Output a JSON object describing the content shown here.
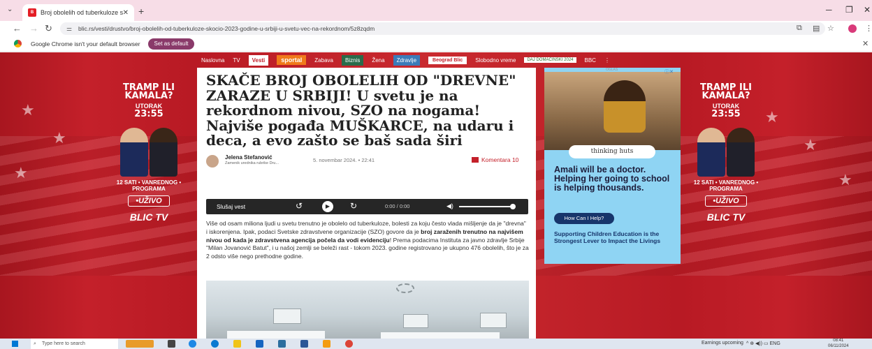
{
  "browser": {
    "tab_title": "Broj obolelih od tuberkuloze ski...",
    "tab_close": "✕",
    "new_tab": "+",
    "url": "blic.rs/vesti/drustvo/broj-obolelih-od-tuberkuloze-skocio-2023-godine-u-srbiji-u-svetu-vec-na-rekordnom/5z8zqdm",
    "infobar_message": "Google Chrome isn't your default browser",
    "infobar_button": "Set as default"
  },
  "nav": {
    "items": [
      "Naslovna",
      "TV",
      "Vesti",
      "sportal",
      "Zabava",
      "Biznis",
      "Žena",
      "Zdravlje",
      "Beograd Blic",
      "Slobodno vreme",
      "DAJ DOMAĆINSKI 2024",
      "BBC",
      "⋮"
    ]
  },
  "side_ad": {
    "headline": "TRAMP ILI KAMALA?",
    "day": "UTORAK",
    "time": "23:55",
    "program": "12 SATI • VANREDNOG • PROGRAMA",
    "live": "•UŽIVO",
    "logo": "BLIC TV"
  },
  "article": {
    "title": "SKAČE BROJ OBOLELIH OD \"DREVNE\" ZARAZE U SRBIJI! U svetu je na rekordnom nivou, SZO na nogama! Najviše pogađa MUŠKARCE, na udaru i deca, a evo zašto se baš sada širi",
    "author": "Jelena Stefanović",
    "author_role": "Zamenik urednika rubrike Dru...",
    "date": "5. novembar 2024.  •  22:41",
    "comments": "Komentara 10",
    "player": {
      "label": "Slušaj vest",
      "time": "0:00 / 0:00"
    },
    "body_p1": "Više od osam miliona ljudi u svetu trenutno je obolelo od tuberkuloze, bolesti za koju često vlada mišljenje da je \"drevna\" i iskorenjena. Ipak, podaci Svetske zdravstvene organizacije (SZO) govore da je ",
    "body_bold": "broj zaraženih trenutno na najvišem nivou od kada je zdravstvena agencija počela da vodi evidenciju",
    "body_p2": "! Prema podacima Instituta za javno zdravlje Srbije \"Milan Jovanović Batut\", i u našoj zemlji se beleži rast - tokom 2023. godine registrovano je ukupno 476 obolelih, što je za 2 odsto više nego prethodne godine."
  },
  "right_ad": {
    "label": "OGLAS",
    "brand": "thinking huts",
    "headline": "Amali will be a doctor. Helping her going to school is helping thousands.",
    "cta": "How Can I Help?",
    "sub": "Supporting Children Education is the Strongest Lever to Impact the Livings"
  },
  "taskbar": {
    "search_placeholder": "Type here to search",
    "earnings": "Earnings upcoming",
    "lang": "ENG",
    "time": "08:41",
    "date": "06/11/2024"
  }
}
